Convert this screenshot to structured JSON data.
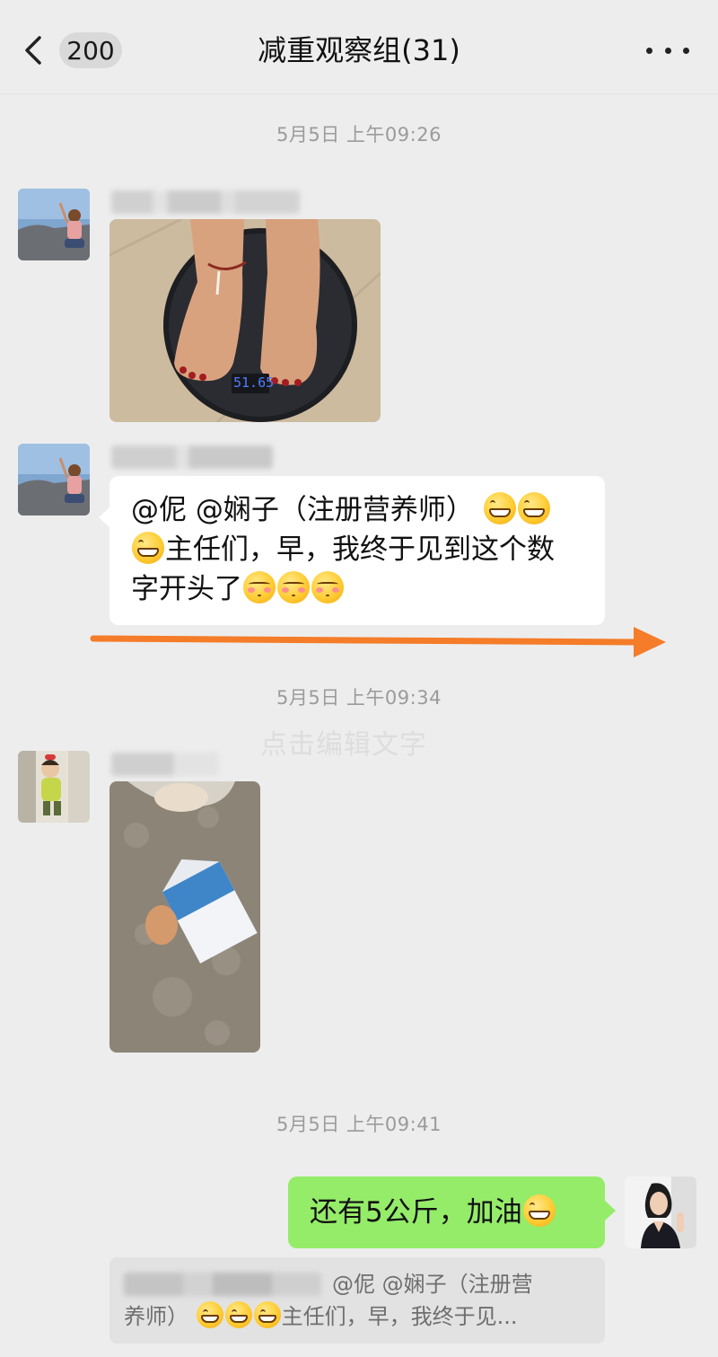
{
  "header": {
    "back_badge": "200",
    "title": "减重观察组(31)"
  },
  "timestamps": [
    "5月5日 上午09:26",
    "5月5日 上午09:34",
    "5月5日 上午09:41"
  ],
  "messages": {
    "m2": {
      "line1_prefix": "@伲  @娴子（注册营养师）",
      "line2_text": "主任们，早，我终于见到这个数",
      "line3_text": "字开头了"
    },
    "m4": {
      "text_before": "还有5公斤，加油"
    },
    "quote": {
      "line1_text": "@伲 @娴子（注册营",
      "line2_prefix": "养师）",
      "line2_suffix": "主任们，早，我终于见..."
    }
  },
  "scale_reading": "51.65",
  "watermark": "点击编辑文字",
  "colors": {
    "background": "#ededed",
    "bubble_self": "#95ec69",
    "bubble_other": "#ffffff",
    "arrow": "#f57c28"
  },
  "icons": [
    "chevron-left-icon",
    "more-icon",
    "grin-emoji-icon",
    "blush-emoji-icon"
  ]
}
